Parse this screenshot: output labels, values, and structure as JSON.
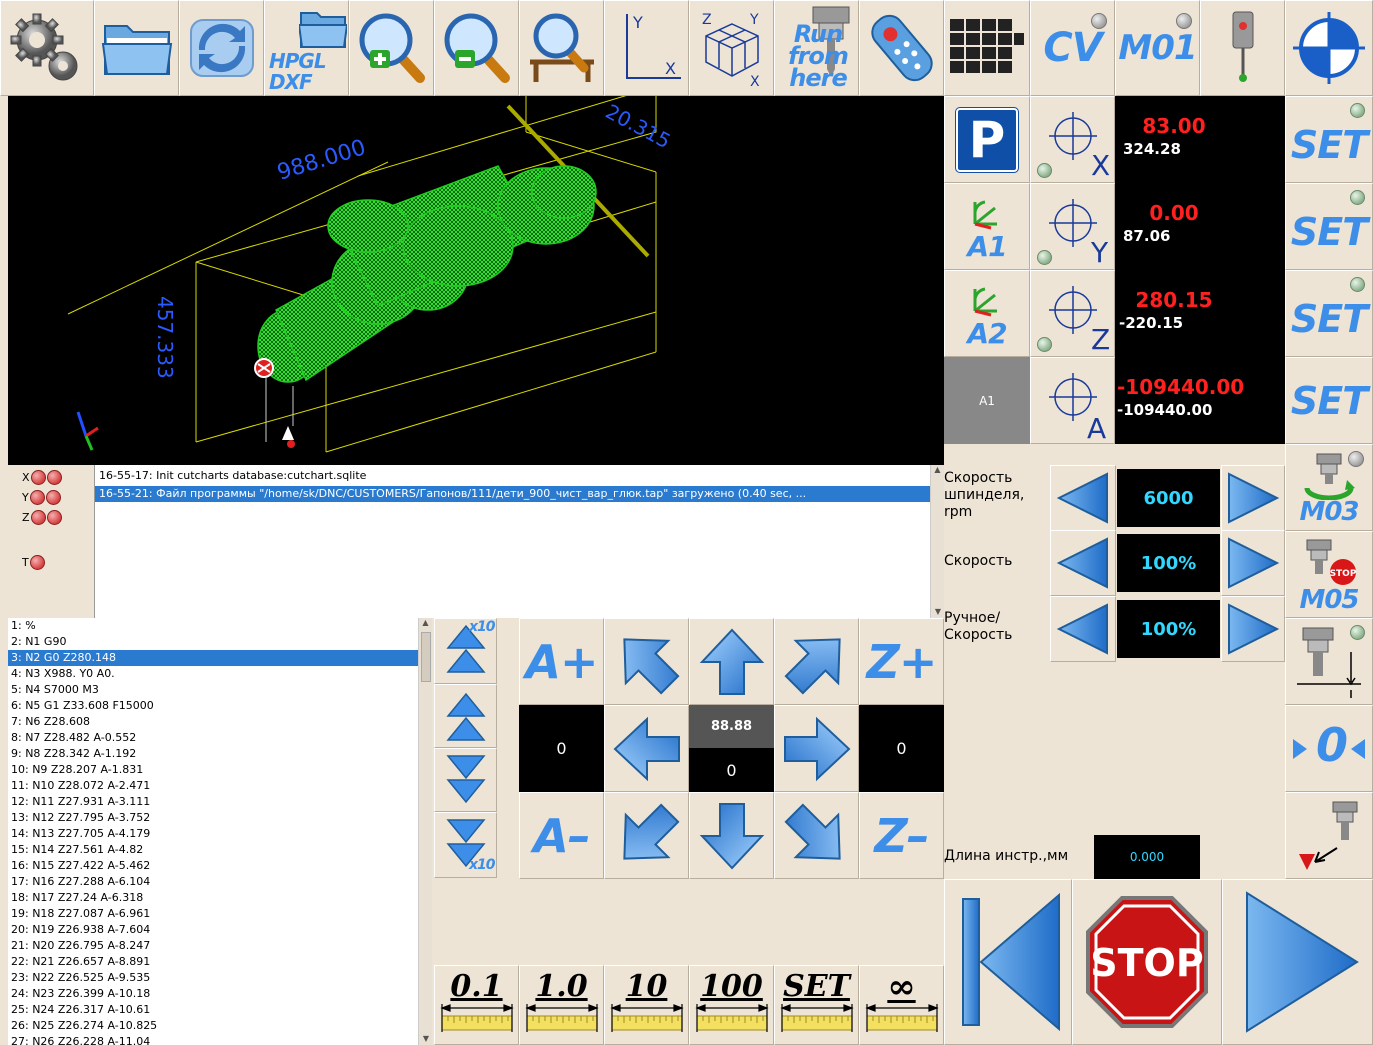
{
  "toolbar": {
    "hpgl_label_1": "HPGL",
    "hpgl_label_2": "DXF",
    "run_from_here_1": "Run",
    "run_from_here_2": "from",
    "run_from_here_3": "here",
    "cv_label": "CV",
    "m01_label": "M01"
  },
  "viewport": {
    "dim_x": "988.000",
    "dim_y": "457.333",
    "dim_z": "20.315"
  },
  "axes": [
    {
      "axis": "X",
      "work": "83.00",
      "machine": "324.28",
      "set": "SET"
    },
    {
      "axis": "Y",
      "work": "0.00",
      "machine": "87.06",
      "set": "SET"
    },
    {
      "axis": "Z",
      "work": "280.15",
      "machine": "-220.15",
      "set": "SET"
    },
    {
      "axis": "A",
      "work": "-109440.00",
      "machine": "-109440.00",
      "set": "SET"
    }
  ],
  "axis_buttons": {
    "a1_label": "A1",
    "a2_label": "A2",
    "a1_gray": "A1"
  },
  "limits": {
    "x": "X",
    "y": "Y",
    "z": "Z",
    "t": "T"
  },
  "log": [
    "16-55-17: Init cutcharts database:cutchart.sqlite",
    "16-55-21: Файл программы \"/home/sk/DNC/CUSTOMERS/Гапонов/111/дети_900_чист_вар_глюк.tap\" загружено (0.40 sec, ..."
  ],
  "speeds": [
    {
      "label": "Скорость шпинделя, rpm",
      "value": "6000"
    },
    {
      "label": "Скорость",
      "value": "100%"
    },
    {
      "label": "Ручное/ Скорость",
      "value": "100%"
    }
  ],
  "spindle": {
    "m03": "M03",
    "m05": "M05",
    "stop_small": "STOP",
    "zero_label": "0"
  },
  "tool_length": {
    "label": "Длина инстр.,мм",
    "value": "0.000"
  },
  "gcode": [
    "1: %",
    "2: N1 G90",
    "3: N2 G0 Z280.148",
    "4: N3 X988. Y0 A0.",
    "5: N4 S7000 M3",
    "6: N5 G1 Z33.608 F15000",
    "7: N6 Z28.608",
    "8: N7 Z28.482 A-0.552",
    "9: N8 Z28.342 A-1.192",
    "10: N9 Z28.207 A-1.831",
    "11: N10 Z28.072 A-2.471",
    "12: N11 Z27.931 A-3.111",
    "13: N12 Z27.795 A-3.752",
    "14: N13 Z27.705 A-4.179",
    "15: N14 Z27.561 A-4.82",
    "16: N15 Z27.422 A-5.462",
    "17: N16 Z27.288 A-6.104",
    "18: N17 Z27.24 A-6.318",
    "19: N18 Z27.087 A-6.961",
    "20: N19 Z26.938 A-7.604",
    "21: N20 Z26.795 A-8.247",
    "22: N21 Z26.657 A-8.891",
    "23: N22 Z26.525 A-9.535",
    "24: N23 Z26.399 A-10.18",
    "25: N24 Z26.317 A-10.61",
    "26: N25 Z26.274 A-10.825",
    "27: N26 Z26.228 A-11.04"
  ],
  "selected_line": 2,
  "feed_x10": "x10",
  "jog": {
    "a_plus": "A+",
    "a_minus": "A–",
    "z_plus": "Z+",
    "z_minus": "Z–",
    "left_val": "0",
    "right_val": "0",
    "center_top": "88.88",
    "center_bot": "0"
  },
  "steps": [
    "0.1",
    "1.0",
    "10",
    "100",
    "SET",
    "∞"
  ],
  "transport": {
    "stop": "STOP"
  },
  "colors": {
    "accent": "#3d8ee8",
    "work_coord": "#ff2020",
    "speed_value": "#30d8ff",
    "viewport_bg": "#000000",
    "model": "#22cc22",
    "bbox": "#d8d800"
  }
}
